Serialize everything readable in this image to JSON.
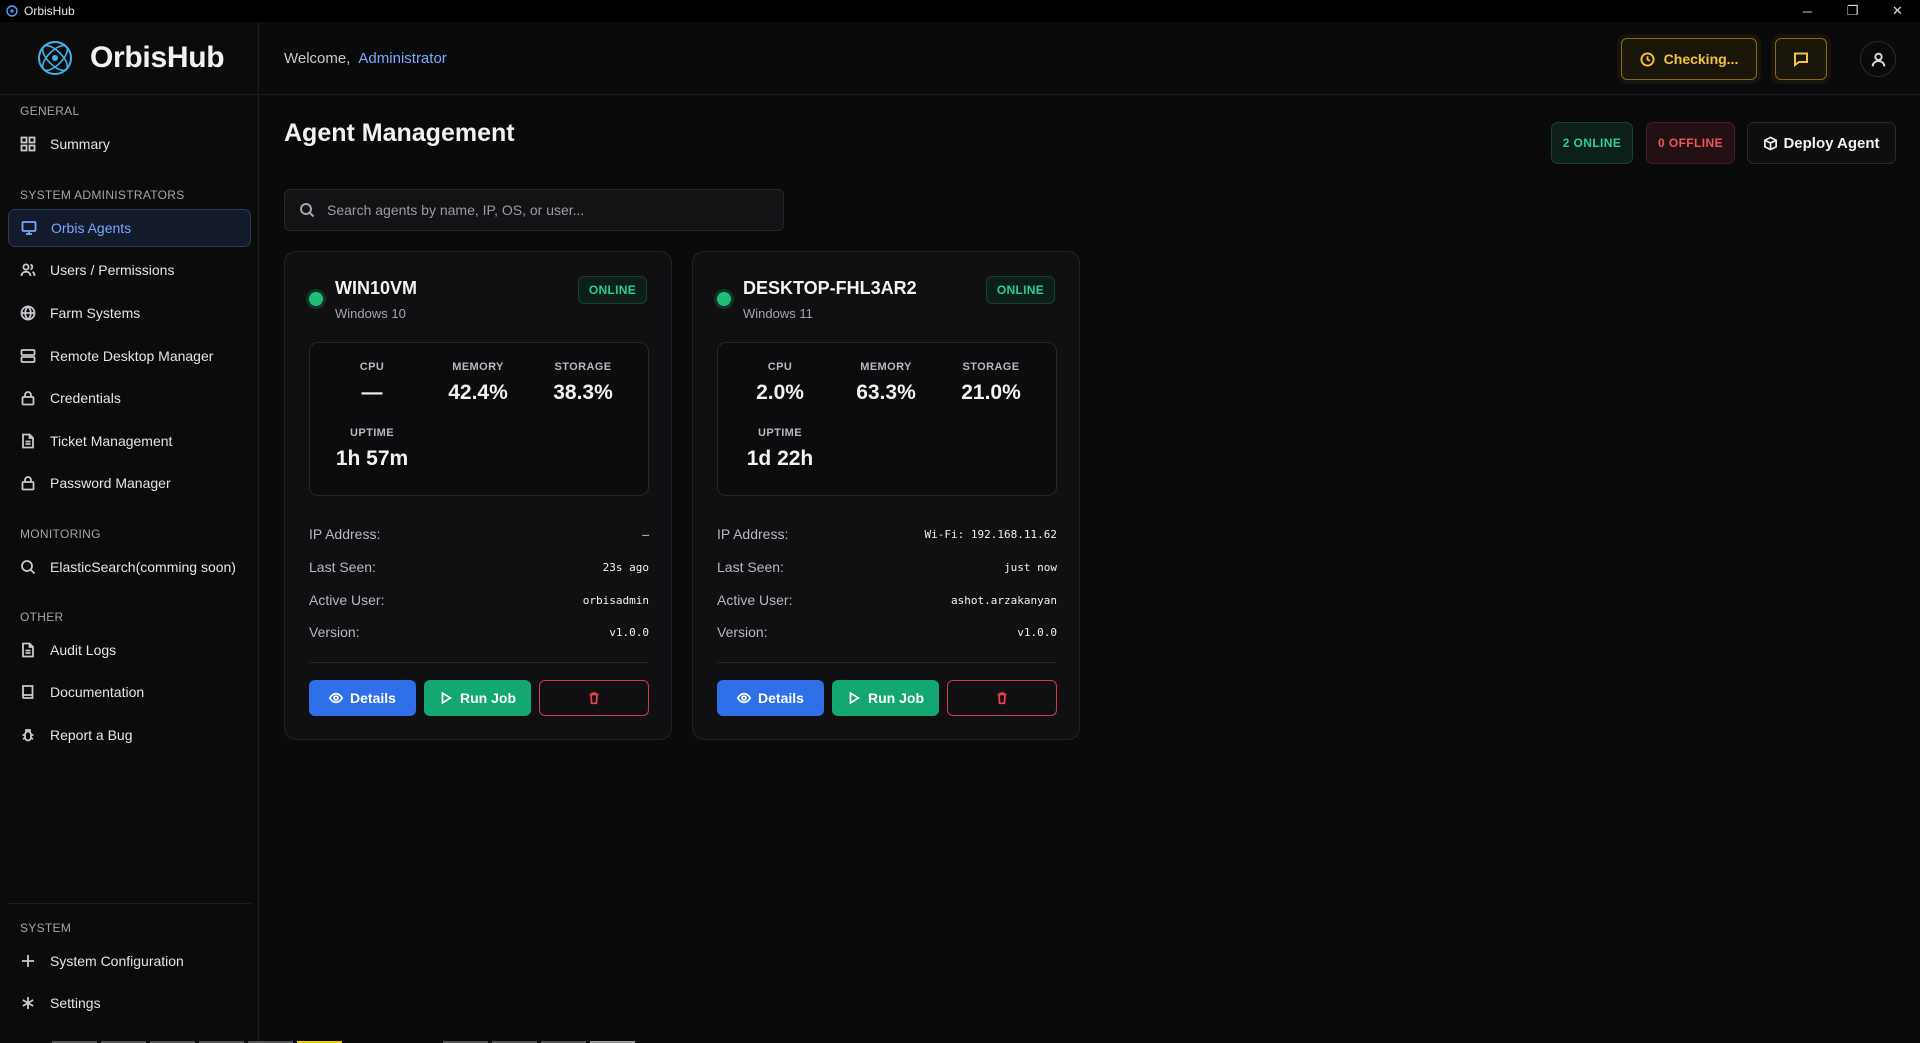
{
  "window": {
    "title": "OrbisHub",
    "minimize": "─",
    "restore": "❐",
    "close": "✕"
  },
  "brand": {
    "name": "OrbisHub"
  },
  "sidebar": {
    "sections": {
      "general": "GENERAL",
      "sysadmins": "SYSTEM ADMINISTRATORS",
      "monitoring": "MONITORING",
      "other": "OTHER",
      "system": "SYSTEM"
    },
    "items": {
      "summary": "Summary",
      "agents": "Orbis Agents",
      "users": "Users / Permissions",
      "farm": "Farm Systems",
      "rdm": "Remote Desktop Manager",
      "credentials": "Credentials",
      "tickets": "Ticket Management",
      "passwords": "Password Manager",
      "elastic": "ElasticSearch(comming soon)",
      "audit": "Audit Logs",
      "docs": "Documentation",
      "bug": "Report a Bug",
      "sysconfig": "System Configuration",
      "settings": "Settings"
    }
  },
  "header": {
    "welcome": "Welcome,",
    "user": "Administrator",
    "status_button": "Checking..."
  },
  "main": {
    "title": "Agent Management",
    "online_pill": "2 ONLINE",
    "offline_pill": "0 OFFLINE",
    "deploy_button": "Deploy Agent",
    "search_placeholder": "Search agents by name, IP, OS, or user..."
  },
  "labels": {
    "cpu": "CPU",
    "memory": "MEMORY",
    "storage": "STORAGE",
    "uptime": "UPTIME",
    "ip": "IP Address:",
    "last_seen": "Last Seen:",
    "active_user": "Active User:",
    "version": "Version:",
    "details": "Details",
    "run_job": "Run Job"
  },
  "agents": [
    {
      "hostname": "WIN10VM",
      "os": "Windows 10",
      "status": "ONLINE",
      "cpu": "—",
      "memory": "42.4%",
      "storage": "38.3%",
      "uptime": "1h 57m",
      "ip": "–",
      "last_seen": "23s ago",
      "active_user": "orbisadmin",
      "version": "v1.0.0"
    },
    {
      "hostname": "DESKTOP-FHL3AR2",
      "os": "Windows 11",
      "status": "ONLINE",
      "cpu": "2.0%",
      "memory": "63.3%",
      "storage": "21.0%",
      "uptime": "1d 22h",
      "ip": "Wi-Fi: 192.168.11.62",
      "last_seen": "just now",
      "active_user": "ashot.arzakanyan",
      "version": "v1.0.0"
    }
  ],
  "colors": {
    "accent": "#7aa7ff",
    "online": "#2ecc8e",
    "offline": "#f0555f",
    "warning": "#f5c23a",
    "primary_button": "#2f6fe8",
    "success_button": "#13a872"
  }
}
